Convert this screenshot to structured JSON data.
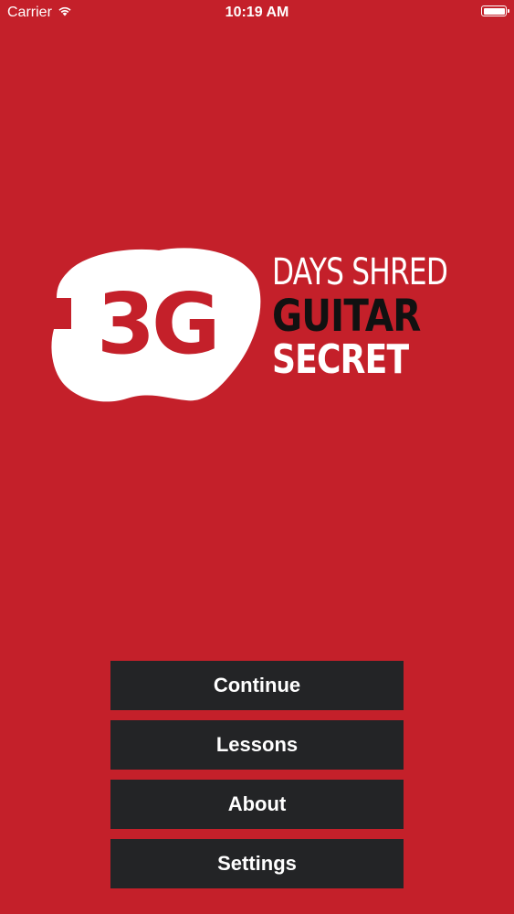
{
  "status_bar": {
    "carrier": "Carrier",
    "time": "10:19 AM",
    "battery_level": 1.0
  },
  "logo": {
    "mark_text": "3G",
    "line1": "DAYS SHRED",
    "line2": "GUITAR",
    "line3": "SECRET"
  },
  "menu": {
    "items": [
      {
        "label": "Continue"
      },
      {
        "label": "Lessons"
      },
      {
        "label": "About"
      },
      {
        "label": "Settings"
      }
    ]
  },
  "colors": {
    "background": "#c4202a",
    "button": "#232426",
    "text": "#ffffff",
    "logo_dark": "#111111"
  }
}
